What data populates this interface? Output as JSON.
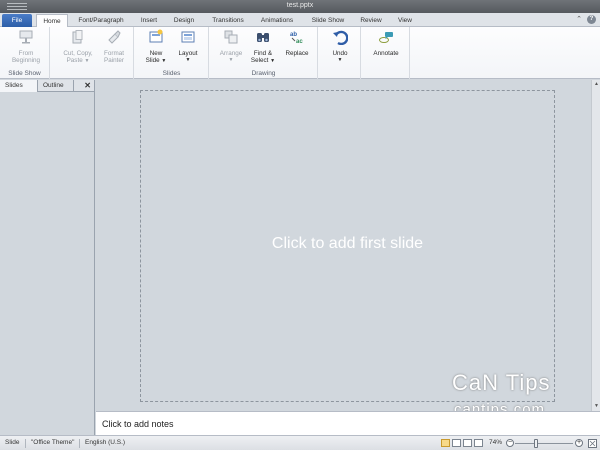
{
  "window": {
    "title": "test.pptx"
  },
  "tabs": [
    {
      "label": "File"
    },
    {
      "label": "Home"
    },
    {
      "label": "Font/Paragraph"
    },
    {
      "label": "Insert"
    },
    {
      "label": "Design"
    },
    {
      "label": "Transitions"
    },
    {
      "label": "Animations"
    },
    {
      "label": "Slide Show"
    },
    {
      "label": "Review"
    },
    {
      "label": "View"
    }
  ],
  "ribbon": {
    "groups": {
      "slideshow": "Slide Show",
      "slides": "Slides",
      "drawing": "Drawing"
    },
    "from_beginning": {
      "line1": "From",
      "line2": "Beginning"
    },
    "cut_copy_paste": {
      "line1": "Cut, Copy,",
      "line2": "Paste"
    },
    "format_painter": {
      "line1": "Format",
      "line2": "Painter"
    },
    "new_slide": {
      "line1": "New",
      "line2": "Slide"
    },
    "layout": {
      "line1": "Layout"
    },
    "arrange": {
      "line1": "Arrange"
    },
    "find_select": {
      "line1": "Find &",
      "line2": "Select"
    },
    "replace": {
      "line1": "Replace"
    },
    "undo": {
      "line1": "Undo"
    },
    "annotate": {
      "line1": "Annotate"
    }
  },
  "panel": {
    "tabs": [
      {
        "label": "Slides"
      },
      {
        "label": "Outline"
      }
    ],
    "close": "✕"
  },
  "editor": {
    "placeholder": "Click to add first slide"
  },
  "notes": {
    "placeholder": "Click to add notes"
  },
  "status": {
    "slide": "Slide",
    "theme": "\"Office Theme\"",
    "language": "English (U.S.)",
    "zoom": "74%",
    "zoom_minus": "−",
    "zoom_plus": "+"
  },
  "watermark": {
    "line1": "CaN Tips",
    "line2": "cantips.com"
  },
  "icons": {
    "help": "?",
    "minimize_ribbon": "⌃",
    "up_arrow": "▲",
    "down_arrow": "▼"
  },
  "colors": {
    "accent": "#2d5ea8",
    "workspace": "#d1d7dd",
    "ribbon": "#f3f5f8"
  }
}
